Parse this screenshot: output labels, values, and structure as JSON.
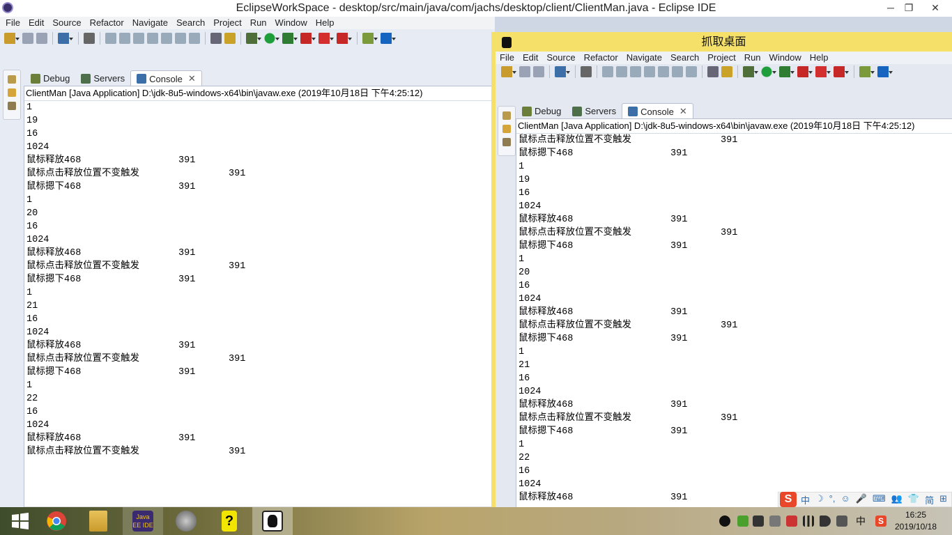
{
  "window": {
    "title": "EclipseWorkSpace - desktop/src/main/java/com/jachs/desktop/client/ClientMan.java - Eclipse IDE",
    "minimize": "─",
    "restore": "❐",
    "close": "✕"
  },
  "menu": [
    "File",
    "Edit",
    "Source",
    "Refactor",
    "Navigate",
    "Search",
    "Project",
    "Run",
    "Window",
    "Help"
  ],
  "tabs": {
    "debug": "Debug",
    "servers": "Servers",
    "console": "Console",
    "close": "✕"
  },
  "console": {
    "header": "ClientMan [Java Application] D:\\jdk-8u5-windows-x64\\bin\\javaw.exe (2019年10月18日 下午4:25:12)",
    "lines_left": [
      [
        "1",
        ""
      ],
      [
        "19",
        ""
      ],
      [
        "16",
        ""
      ],
      [
        "1024",
        ""
      ],
      [
        "鼠标释放468",
        "391"
      ],
      [
        "鼠标点击释放位置不变触发",
        "391"
      ],
      [
        "鼠标摁下468",
        "391"
      ],
      [
        "1",
        ""
      ],
      [
        "20",
        ""
      ],
      [
        "16",
        ""
      ],
      [
        "1024",
        ""
      ],
      [
        "鼠标释放468",
        "391"
      ],
      [
        "鼠标点击释放位置不变触发",
        "391"
      ],
      [
        "鼠标摁下468",
        "391"
      ],
      [
        "1",
        ""
      ],
      [
        "21",
        ""
      ],
      [
        "16",
        ""
      ],
      [
        "1024",
        ""
      ],
      [
        "鼠标释放468",
        "391"
      ],
      [
        "鼠标点击释放位置不变触发",
        "391"
      ],
      [
        "鼠标摁下468",
        "391"
      ],
      [
        "1",
        ""
      ],
      [
        "22",
        ""
      ],
      [
        "16",
        ""
      ],
      [
        "1024",
        ""
      ],
      [
        "鼠标释放468",
        "391"
      ],
      [
        "鼠标点击释放位置不变触发",
        "391"
      ]
    ],
    "lines_right": [
      [
        "鼠标点击释放位置不变触发",
        "391"
      ],
      [
        "鼠标摁下468",
        "391"
      ],
      [
        "1",
        ""
      ],
      [
        "19",
        ""
      ],
      [
        "16",
        ""
      ],
      [
        "1024",
        ""
      ],
      [
        "鼠标释放468",
        "391"
      ],
      [
        "鼠标点击释放位置不变触发",
        "391"
      ],
      [
        "鼠标摁下468",
        "391"
      ],
      [
        "1",
        ""
      ],
      [
        "20",
        ""
      ],
      [
        "16",
        ""
      ],
      [
        "1024",
        ""
      ],
      [
        "鼠标释放468",
        "391"
      ],
      [
        "鼠标点击释放位置不变触发",
        "391"
      ],
      [
        "鼠标摁下468",
        "391"
      ],
      [
        "1",
        ""
      ],
      [
        "21",
        ""
      ],
      [
        "16",
        ""
      ],
      [
        "1024",
        ""
      ],
      [
        "鼠标释放468",
        "391"
      ],
      [
        "鼠标点击释放位置不变触发",
        "391"
      ],
      [
        "鼠标摁下468",
        "391"
      ],
      [
        "1",
        ""
      ],
      [
        "22",
        ""
      ],
      [
        "16",
        ""
      ],
      [
        "1024",
        ""
      ],
      [
        "鼠标释放468",
        "391"
      ]
    ]
  },
  "capture_window": {
    "title": "抓取桌面"
  },
  "ime": {
    "logo": "S",
    "glyphs": [
      "中",
      "☽",
      "°,",
      "☺",
      "🎤",
      "⌨",
      "👥",
      "👕",
      "简",
      "⊞"
    ]
  },
  "taskbar": {
    "apps": [
      "windows-start",
      "chrome",
      "file-explorer",
      "eclipse-javaee",
      "chat-app",
      "help-app",
      "che-app"
    ],
    "eclipse_label": "Java EE IDE",
    "tray_lang": "中",
    "time": "16:25",
    "date": "2019/10/18"
  },
  "colors": {
    "capture_border": "#f5e06a",
    "ime_brand": "#e8472a"
  }
}
